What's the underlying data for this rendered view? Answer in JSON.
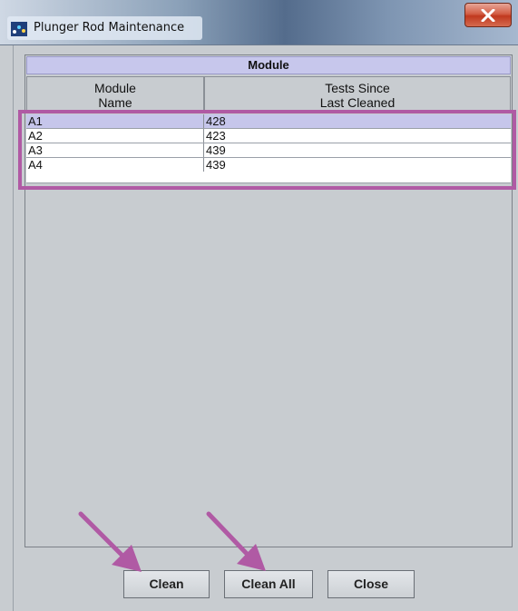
{
  "window": {
    "title": "Plunger Rod Maintenance",
    "close_icon": "close-x-icon",
    "app_icon": "app-icon"
  },
  "table": {
    "group_header": "Module",
    "columns": [
      {
        "line1": "Module",
        "line2": "Name"
      },
      {
        "line1": "Tests Since",
        "line2": "Last Cleaned"
      }
    ],
    "rows": [
      {
        "name": "A1",
        "tests": "428",
        "selected": true
      },
      {
        "name": "A2",
        "tests": "423",
        "selected": false
      },
      {
        "name": "A3",
        "tests": "439",
        "selected": false
      },
      {
        "name": "A4",
        "tests": "439",
        "selected": false
      }
    ]
  },
  "buttons": {
    "clean": "Clean",
    "clean_all": "Clean All",
    "close": "Close"
  },
  "annotation": {
    "highlight_color": "#b05aa4",
    "arrow_color": "#b05aa4"
  }
}
